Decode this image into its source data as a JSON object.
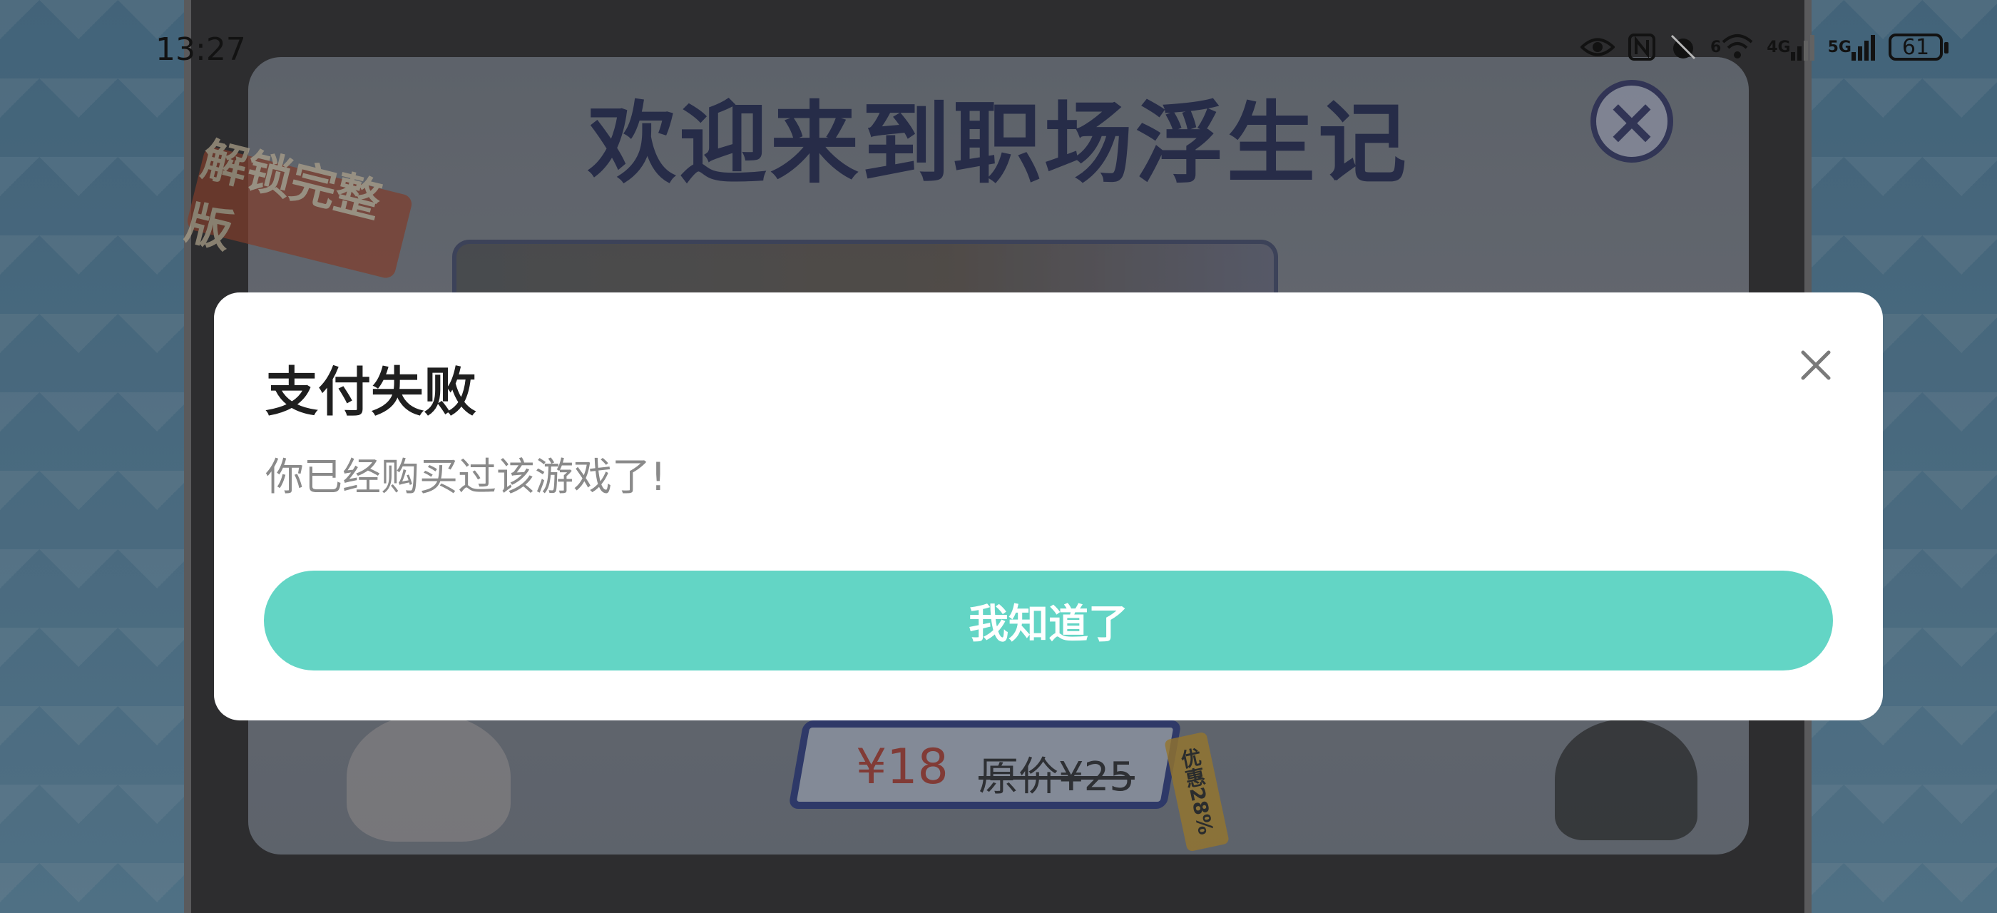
{
  "status_bar": {
    "time": "13:27",
    "network_6": "6",
    "network_4g": "4G",
    "network_5g": "5G",
    "battery": "61"
  },
  "game": {
    "title": "欢迎来到职场浮生记",
    "unlock_badge": "解锁完整版",
    "price_current": "¥18",
    "price_original": "原价¥25",
    "discount": "优惠28%"
  },
  "dialog": {
    "title": "支付失败",
    "message": "你已经购买过该游戏了!",
    "confirm_label": "我知道了"
  },
  "colors": {
    "confirm_button": "#63d5c5",
    "dialog_bg": "#ffffff",
    "title_text": "#1f1f1f",
    "message_text": "#8a8a8a"
  }
}
